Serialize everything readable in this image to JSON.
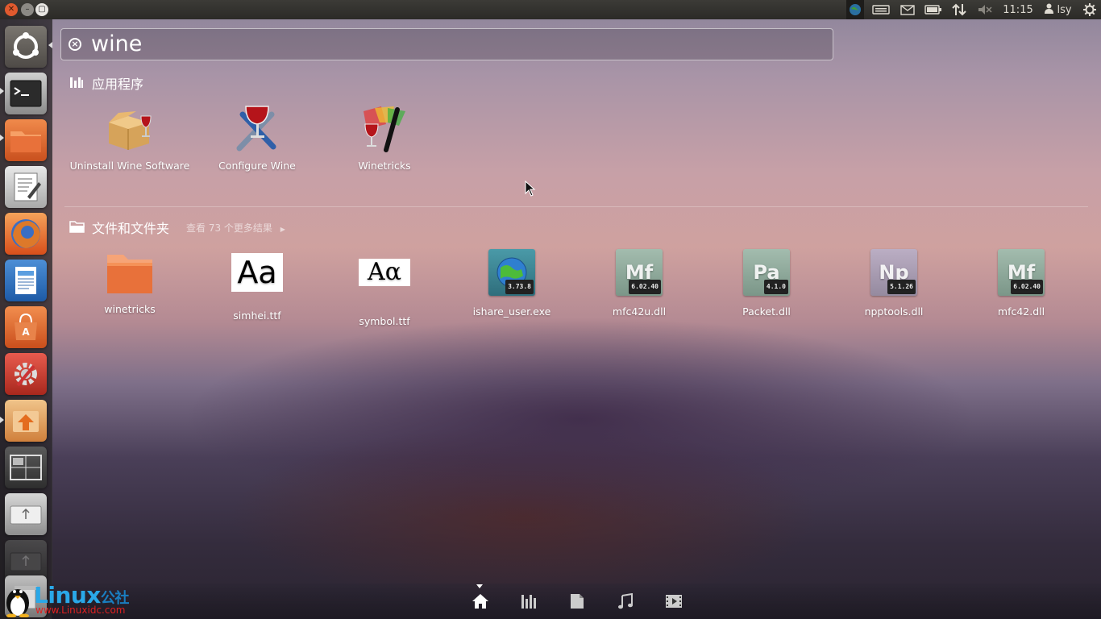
{
  "panel": {
    "clock": "11:15",
    "user": "lsy"
  },
  "search": {
    "query": "wine"
  },
  "applications": {
    "title": "应用程序",
    "items": [
      {
        "label": "Uninstall Wine Software",
        "icon": "wine-uninstall-icon"
      },
      {
        "label": "Configure Wine",
        "icon": "wine-config-icon"
      },
      {
        "label": "Winetricks",
        "icon": "winetricks-icon"
      }
    ]
  },
  "files": {
    "title": "文件和文件夹",
    "more": "查看 73 个更多结果",
    "items": [
      {
        "label": "winetricks",
        "icon": "folder-icon"
      },
      {
        "label": "simhei.ttf",
        "icon": "font-icon",
        "glyph": "Aa"
      },
      {
        "label": "symbol.ttf",
        "icon": "font-icon",
        "glyph": "Aα"
      },
      {
        "label": "ishare_user.exe",
        "icon": "globe-exe-icon",
        "version": "3.73.8"
      },
      {
        "label": "mfc42u.dll",
        "icon": "dll-icon",
        "abbr": "Mf",
        "version": "6.02.40",
        "color": "#8ea79a"
      },
      {
        "label": "Packet.dll",
        "icon": "dll-icon",
        "abbr": "Pa",
        "version": "4.1.0",
        "color": "#8ea79a"
      },
      {
        "label": "npptools.dll",
        "icon": "dll-icon",
        "abbr": "Np",
        "version": "5.1.26",
        "color": "#a79aae"
      },
      {
        "label": "mfc42.dll",
        "icon": "dll-icon",
        "abbr": "Mf",
        "version": "6.02.40",
        "color": "#8ea79a"
      }
    ]
  },
  "watermark": {
    "brand": "Linux",
    "brand_cn": "公社",
    "url": "www.Linuxidc.com"
  },
  "colors": {
    "accent": "#e05a2e",
    "folder": "#e8713a"
  }
}
